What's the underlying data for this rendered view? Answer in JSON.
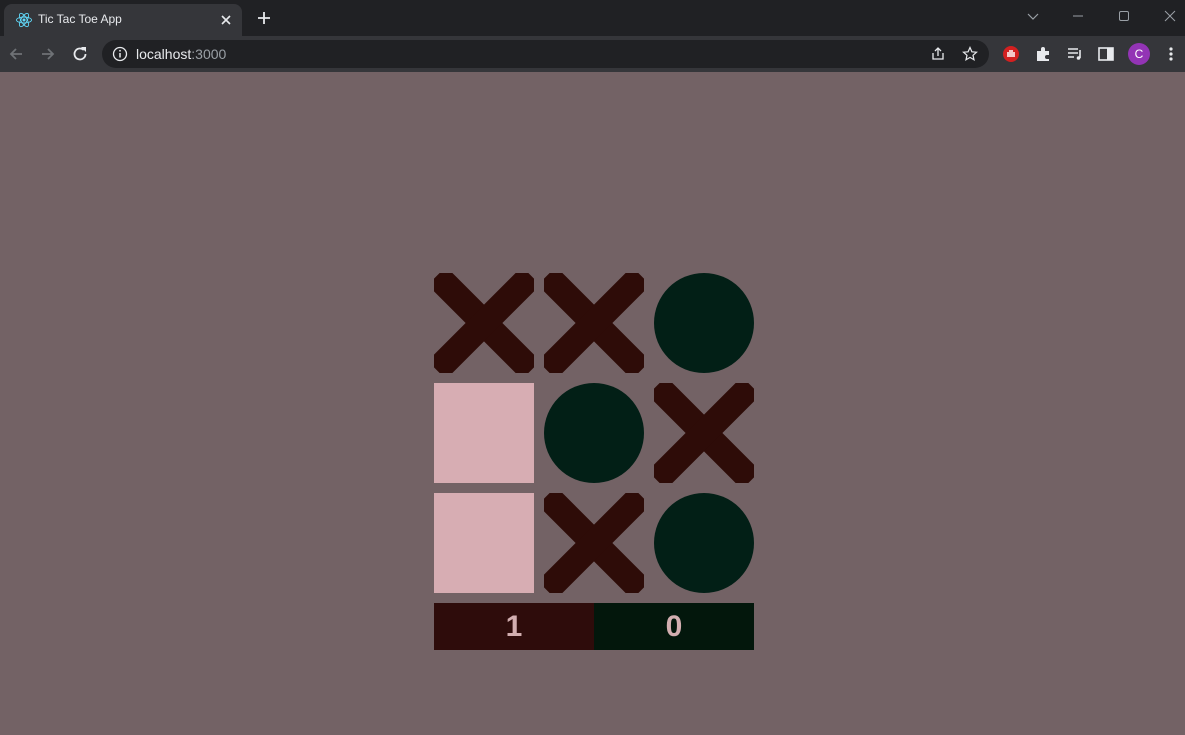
{
  "browser": {
    "tab_title": "Tic Tac Toe App",
    "url_host": "localhost",
    "url_rest": ":3000",
    "avatar_letter": "C"
  },
  "colors": {
    "background": "#736265",
    "x_mark": "#2e0c08",
    "o_mark": "#021f16",
    "empty_cell": "#d7adb3",
    "x_score_bg": "#2e0c0b",
    "o_score_bg": "#03170c",
    "score_text": "#d2aeb0"
  },
  "game": {
    "board": [
      "X",
      "X",
      "O",
      "",
      "O",
      "X",
      "",
      "X",
      "O"
    ],
    "scores": {
      "x": "1",
      "o": "0"
    }
  }
}
